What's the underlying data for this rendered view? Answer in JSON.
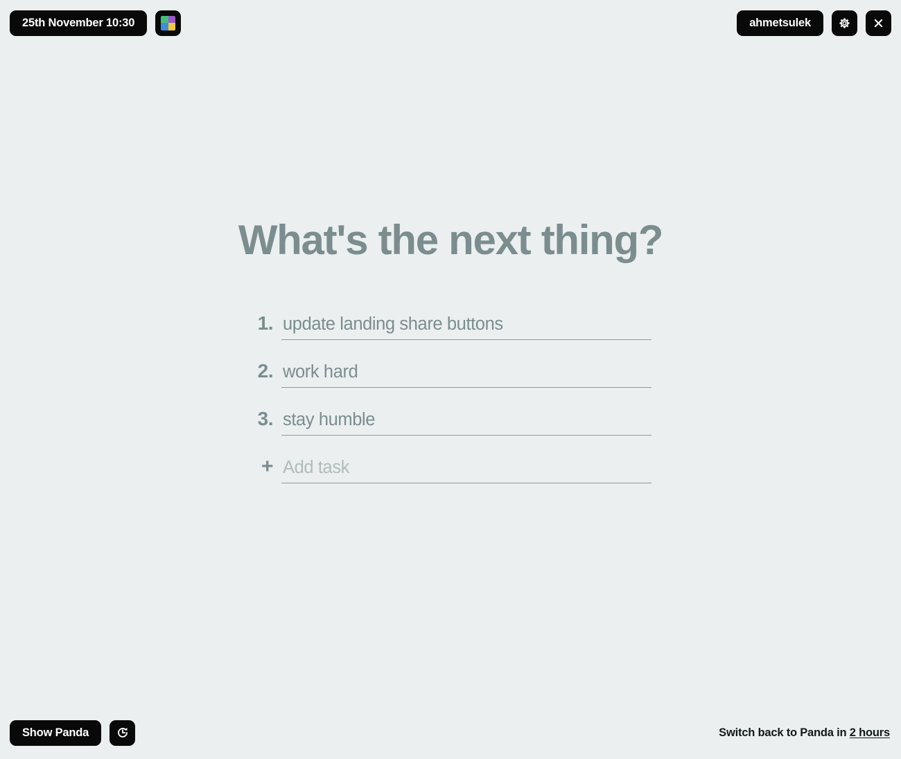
{
  "topbar": {
    "datetime_label": "25th November 10:30",
    "apps_icon": "grid-apps-icon",
    "apps_colors": {
      "top_left": "#43c07c",
      "top_right": "#9b59c9",
      "bottom_left": "#3d8fdd",
      "bottom_right": "#f2c93b"
    },
    "username": "ahmetsulek",
    "settings_icon": "gear-icon",
    "close_icon": "close-icon"
  },
  "main": {
    "headline": "What's the next thing?",
    "tasks": [
      {
        "number": "1.",
        "value": "update landing share buttons",
        "placeholder": ""
      },
      {
        "number": "2.",
        "value": "work hard",
        "placeholder": ""
      },
      {
        "number": "3.",
        "value": "stay humble",
        "placeholder": ""
      }
    ],
    "add_task": {
      "number": "+",
      "value": "",
      "placeholder": "Add task"
    }
  },
  "bottombar": {
    "show_panda_label": "Show Panda",
    "refresh_icon": "refresh-icon",
    "switch_prefix": "Switch back to Panda in ",
    "switch_link": "2 hours"
  },
  "colors": {
    "background": "#ebeff0",
    "ink": "#090909",
    "muted_text": "#7b8d8e",
    "placeholder": "#b0bbbc",
    "rule": "#8a9a9b"
  }
}
